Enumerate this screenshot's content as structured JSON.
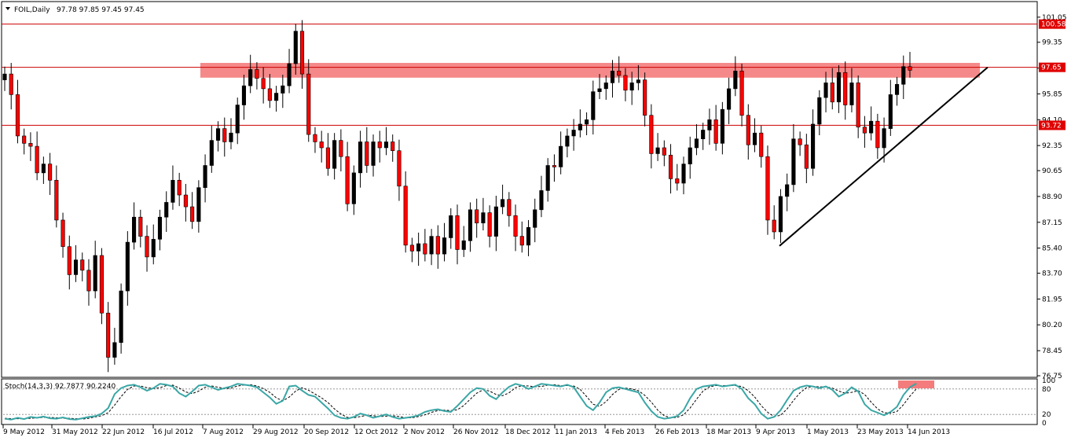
{
  "header": {
    "symbol": "FOIL,Daily",
    "ohlc": "97.78 97.85 97.45 97.45"
  },
  "stoch": {
    "label": "Stoch(14,3,3) 92.7877 90.2240",
    "levels": [
      80,
      20
    ],
    "scale": [
      "100",
      "80",
      "20",
      "0"
    ]
  },
  "colors": {
    "bull": "#000000",
    "bear": "#ff0000",
    "hline": "#cc0000",
    "zone": "#f47c7c",
    "stoch_main": "#3aa6a6",
    "stoch_signal": "#000000",
    "tag_bg": "#e00000"
  },
  "chart_data": {
    "type": "candlestick",
    "title": "FOIL,Daily",
    "ylim": [
      76.75,
      102.0
    ],
    "y_ticks": [
      "101.05",
      "99.35",
      "97.60",
      "95.85",
      "94.10",
      "92.35",
      "90.65",
      "88.90",
      "87.15",
      "85.40",
      "83.70",
      "81.95",
      "80.20",
      "78.45",
      "76.75"
    ],
    "x_ticks": [
      "9 May 2012",
      "31 May 2012",
      "22 Jun 2012",
      "16 Jul 2012",
      "7 Aug 2012",
      "29 Aug 2012",
      "20 Sep 2012",
      "12 Oct 2012",
      "2 Nov 2012",
      "26 Nov 2012",
      "18 Dec 2012",
      "11 Jan 2013",
      "4 Feb 2013",
      "26 Feb 2013",
      "18 Mar 2013",
      "9 Apr 2013",
      "1 May 2013",
      "23 May 2013",
      "14 Jun 2013"
    ],
    "horizontal_lines": [
      {
        "value": 100.58,
        "label": "100.58"
      },
      {
        "value": 97.65,
        "label": "97.65"
      },
      {
        "value": 93.72,
        "label": "93.72"
      }
    ],
    "resistance_zone": {
      "from": 96.95,
      "to": 97.95,
      "start": "7 Aug 2012",
      "end": "14 Jun 2013"
    },
    "trendline": {
      "from": {
        "date": "9 Apr 2013",
        "value": 85.55
      },
      "to": {
        "date": "14 Jun 2013",
        "value": 97.65
      }
    },
    "closes": [
      97.2,
      95.8,
      93.0,
      92.5,
      92.3,
      90.5,
      91.1,
      90.0,
      87.3,
      85.5,
      83.6,
      84.6,
      83.9,
      82.5,
      84.9,
      81.0,
      78.0,
      79.0,
      82.5,
      85.8,
      87.5,
      86.2,
      84.8,
      86.0,
      87.5,
      88.5,
      90.0,
      89.0,
      88.2,
      87.2,
      89.5,
      91.0,
      92.7,
      93.5,
      92.6,
      93.2,
      95.1,
      96.4,
      97.5,
      96.9,
      96.2,
      95.4,
      95.9,
      96.4,
      97.9,
      100.1,
      97.2,
      93.1,
      92.6,
      92.2,
      90.8,
      92.7,
      91.6,
      88.4,
      90.5,
      92.6,
      91.0,
      92.6,
      92.2,
      92.6,
      92.0,
      89.6,
      85.6,
      85.2,
      85.7,
      85.0,
      86.2,
      85.0,
      86.1,
      87.6,
      85.3,
      85.9,
      88.0,
      87.1,
      87.8,
      86.2,
      88.2,
      88.7,
      87.6,
      86.2,
      85.6,
      86.8,
      88.0,
      89.3,
      91.0,
      90.9,
      92.3,
      93.0,
      93.4,
      93.8,
      94.1,
      96.0,
      96.2,
      96.6,
      97.4,
      97.1,
      96.1,
      96.6,
      96.8,
      94.4,
      91.8,
      92.2,
      91.7,
      90.1,
      89.8,
      91.1,
      92.2,
      92.8,
      93.4,
      94.1,
      92.5,
      94.8,
      96.2,
      97.4,
      94.4,
      92.4,
      93.2,
      91.6,
      87.3,
      86.5,
      88.9,
      89.7,
      92.8,
      92.4,
      90.8,
      93.8,
      95.6,
      96.6,
      95.3,
      97.3,
      95.1,
      96.6,
      93.6,
      93.2,
      94.0,
      92.2,
      93.5,
      95.8,
      96.5,
      97.7,
      97.45
    ],
    "stoch_k": [
      10,
      8,
      12,
      9,
      14,
      12,
      15,
      11,
      10,
      13,
      9,
      8,
      11,
      14,
      16,
      22,
      35,
      68,
      82,
      88,
      90,
      84,
      76,
      82,
      92,
      90,
      86,
      70,
      62,
      74,
      88,
      90,
      84,
      78,
      82,
      86,
      92,
      90,
      88,
      84,
      72,
      60,
      45,
      52,
      86,
      88,
      76,
      66,
      62,
      48,
      34,
      18,
      12,
      10,
      14,
      22,
      18,
      12,
      16,
      20,
      14,
      10,
      12,
      14,
      18,
      26,
      30,
      32,
      28,
      26,
      40,
      56,
      72,
      82,
      80,
      64,
      56,
      72,
      85,
      92,
      88,
      80,
      86,
      92,
      90,
      88,
      86,
      90,
      84,
      62,
      40,
      30,
      48,
      72,
      82,
      84,
      80,
      76,
      72,
      48,
      28,
      14,
      10,
      12,
      16,
      30,
      58,
      80,
      86,
      88,
      90,
      86,
      88,
      90,
      80,
      58,
      44,
      22,
      10,
      14,
      30,
      54,
      76,
      84,
      88,
      86,
      82,
      86,
      78,
      62,
      70,
      84,
      74,
      44,
      30,
      24,
      18,
      26,
      38,
      66,
      84,
      92.79
    ],
    "stoch_d": [
      11,
      10,
      10,
      10,
      11,
      12,
      13,
      13,
      12,
      11,
      11,
      10,
      9,
      11,
      14,
      17,
      24,
      42,
      62,
      79,
      87,
      87,
      83,
      81,
      83,
      88,
      89,
      82,
      73,
      69,
      75,
      84,
      87,
      84,
      81,
      82,
      87,
      89,
      90,
      87,
      81,
      72,
      59,
      52,
      61,
      75,
      83,
      77,
      68,
      59,
      48,
      33,
      21,
      13,
      12,
      15,
      18,
      17,
      15,
      16,
      17,
      15,
      12,
      12,
      15,
      19,
      25,
      29,
      30,
      29,
      31,
      41,
      56,
      70,
      78,
      75,
      67,
      64,
      71,
      83,
      88,
      87,
      85,
      86,
      89,
      90,
      88,
      88,
      87,
      79,
      62,
      44,
      39,
      50,
      67,
      79,
      82,
      80,
      76,
      65,
      49,
      30,
      17,
      12,
      13,
      19,
      35,
      56,
      75,
      85,
      88,
      88,
      88,
      88,
      86,
      76,
      61,
      41,
      25,
      15,
      18,
      33,
      53,
      71,
      83,
      86,
      85,
      85,
      82,
      75,
      70,
      72,
      76,
      67,
      49,
      33,
      24,
      23,
      27,
      43,
      63,
      80.22
    ]
  }
}
